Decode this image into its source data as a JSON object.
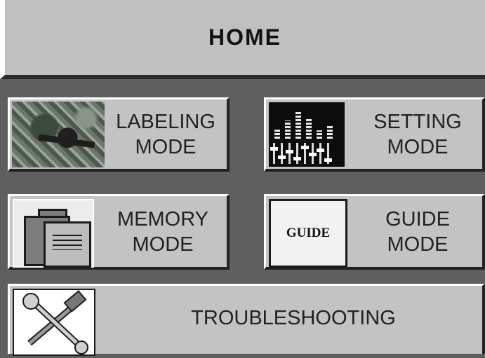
{
  "header": {
    "title": "HOME"
  },
  "buttons": {
    "labeling": {
      "line1": "LABELING",
      "line2": "MODE",
      "icon": "labeling-photo-icon"
    },
    "setting": {
      "line1": "SETTING",
      "line2": "MODE",
      "icon": "equalizer-sliders-icon"
    },
    "memory": {
      "line1": "MEMORY",
      "line2": "MODE",
      "icon": "folder-document-icon"
    },
    "guide": {
      "line1": "GUIDE",
      "line2": "MODE",
      "icon": "guide-book-icon",
      "icon_text": "GUIDE"
    },
    "troubleshooting": {
      "label": "TROUBLESHOOTING",
      "icon": "hammer-wrench-icon"
    }
  },
  "colors": {
    "background": "#5f5f5f",
    "button": "#c3c3c3",
    "header": "#c0c0c0"
  }
}
